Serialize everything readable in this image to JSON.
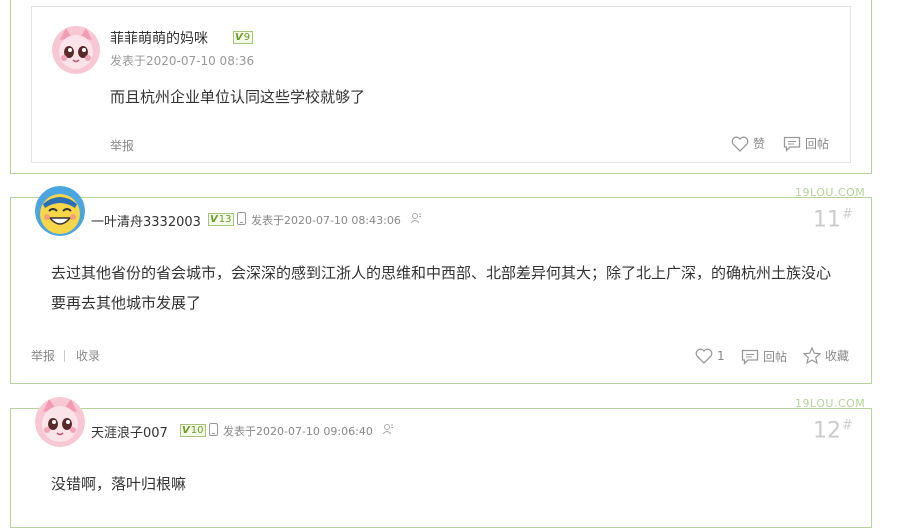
{
  "post_top": {
    "reply": {
      "author": "菲菲萌萌的妈咪",
      "level": "9",
      "meta": "发表于2020-07-10 08:36",
      "text": "而且杭州企业单位认同这些学校就够了",
      "report": "举报",
      "like": "赞",
      "reply": "回帖"
    }
  },
  "post_11": {
    "watermark": "19LOU.COM",
    "author": "一叶清舟3332003",
    "level": "13",
    "meta": "发表于2020-07-10  08:43:06",
    "floor": "11",
    "text": "去过其他省份的省会城市，会深深的感到江浙人的思维和中西部、北部差异何其大；除了北上广深，的确杭州土族没心要再去其他城市发展了",
    "report": "举报",
    "collect_link": "收录",
    "like_count": "1",
    "reply": "回帖",
    "favorite": "收藏"
  },
  "post_12": {
    "watermark": "19LOU.COM",
    "author": "天涯浪子007",
    "level": "10",
    "meta": "发表于2020-07-10  09:06:40",
    "floor": "12",
    "text": "没错啊，落叶归根嘛"
  },
  "colors": {
    "border": "#b6d39a",
    "badge_green": "#6b9b2c",
    "muted": "#888888"
  }
}
